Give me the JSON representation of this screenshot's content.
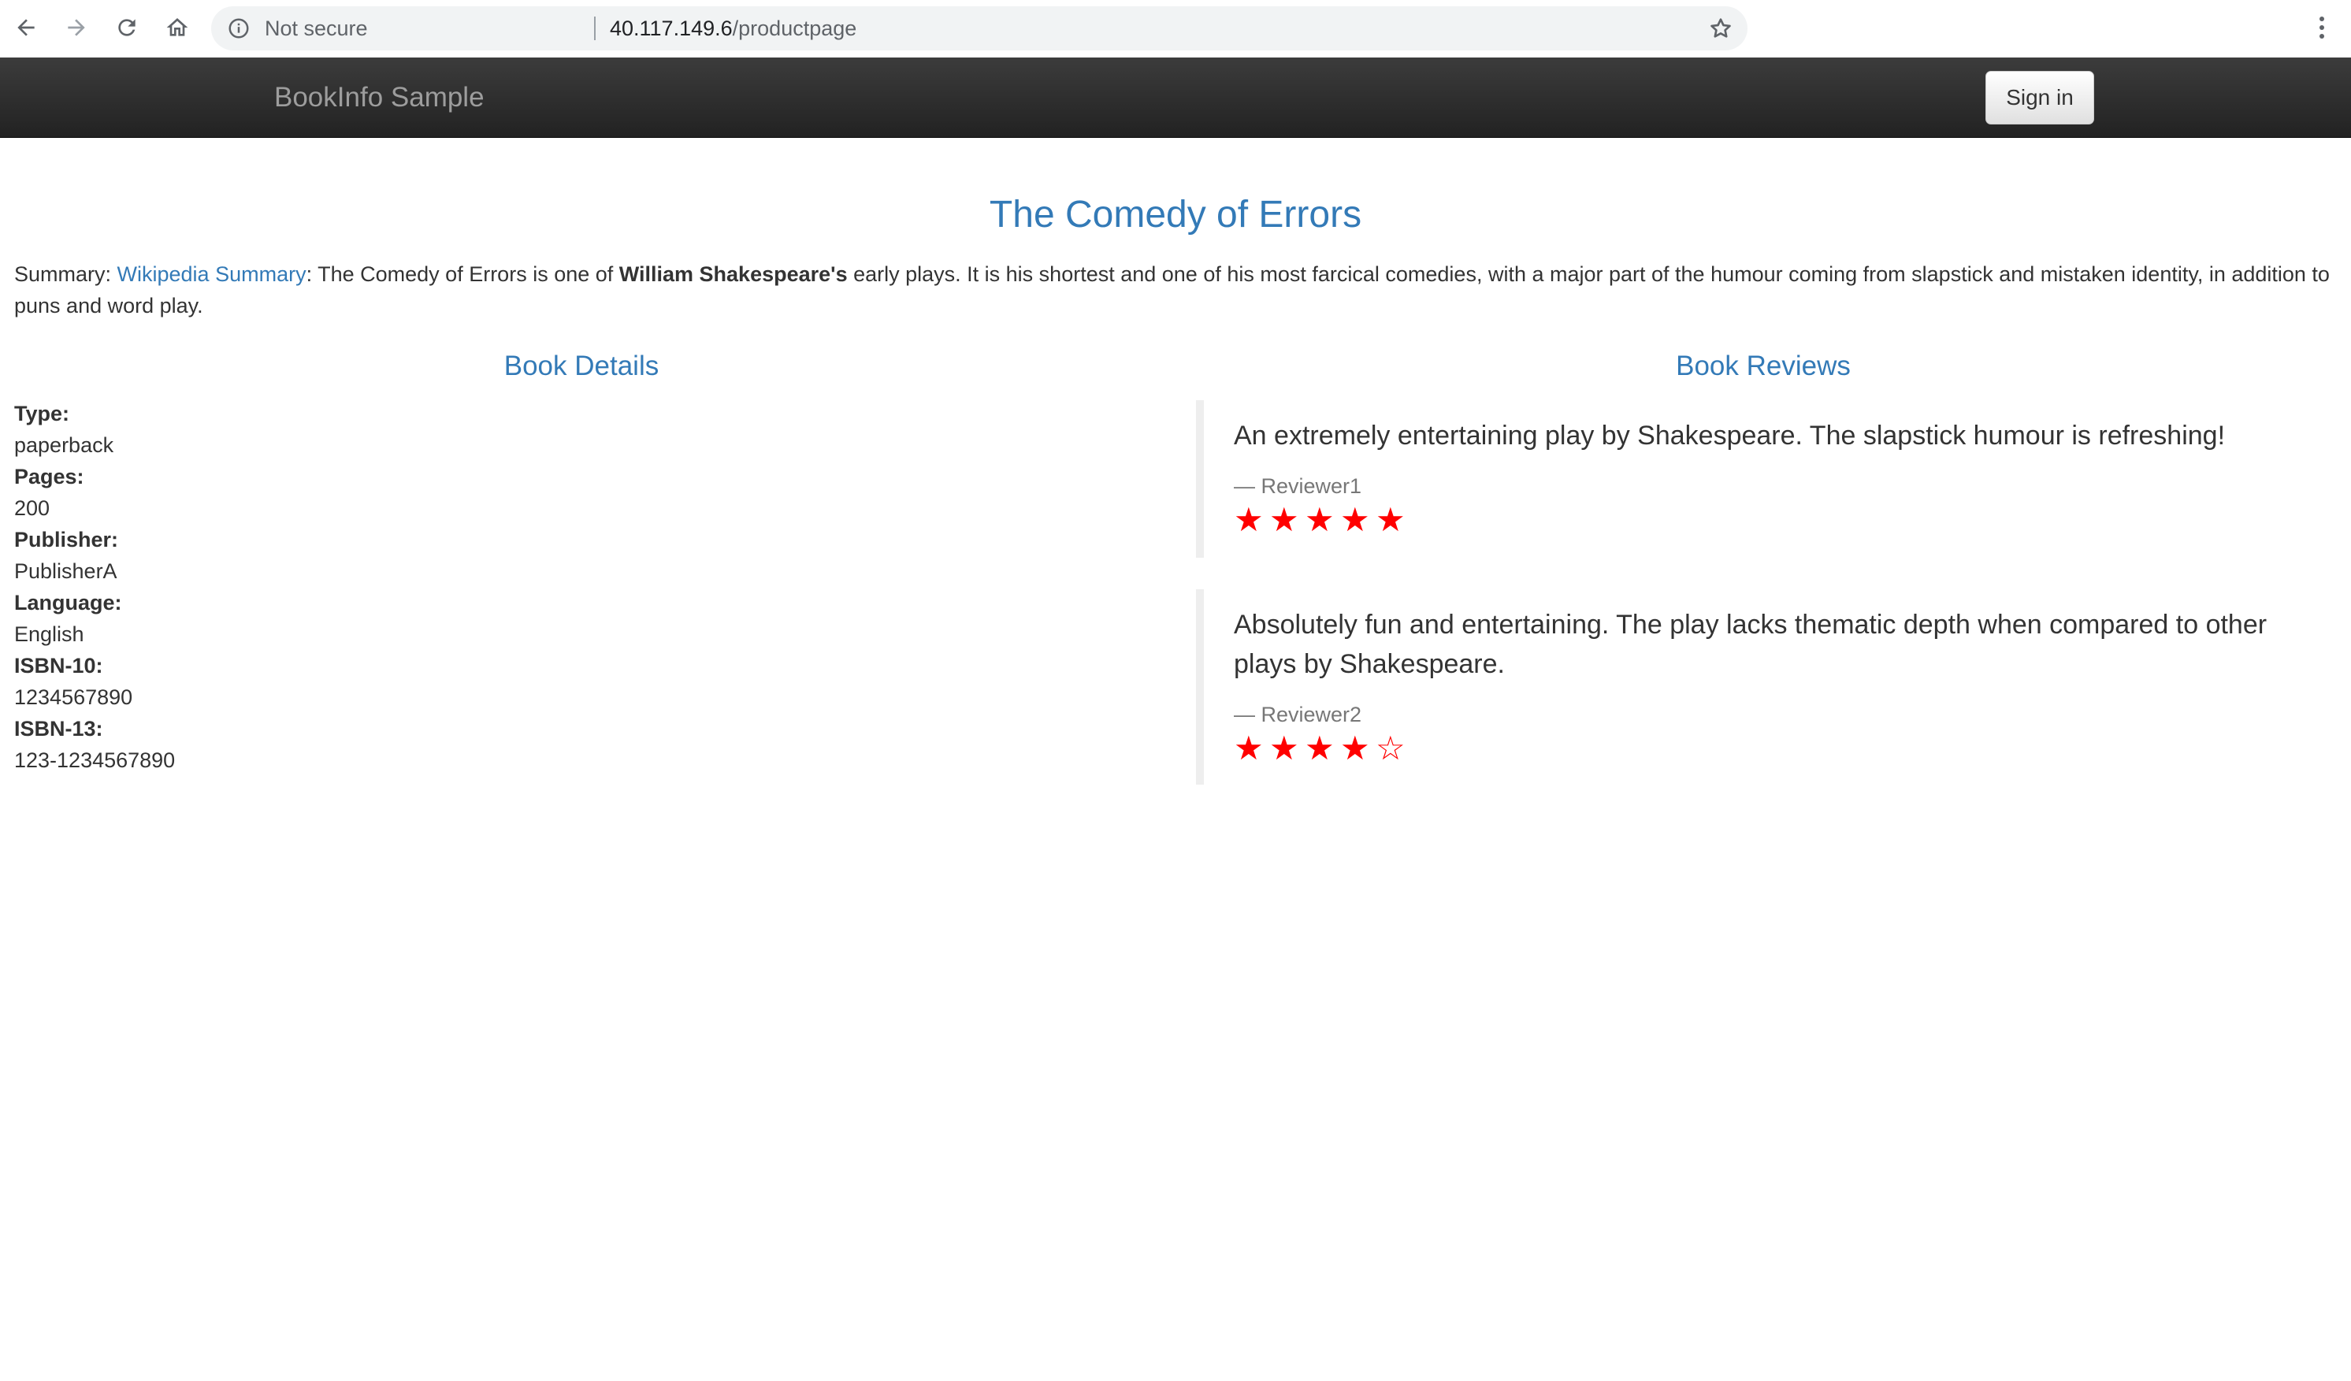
{
  "browser": {
    "back_icon": "arrow-left-icon",
    "forward_icon": "arrow-right-icon",
    "reload_icon": "reload-icon",
    "home_icon": "home-icon",
    "security_label": "Not secure",
    "url_host": "40.117.149.6",
    "url_path": "/productpage",
    "bookmark_icon": "star-outline-icon",
    "menu_icon": "kebab-menu-icon"
  },
  "navbar": {
    "brand": "BookInfo Sample",
    "signin_label": "Sign in"
  },
  "book": {
    "title": "The Comedy of Errors",
    "summary_prefix": "Summary: ",
    "summary_link": "Wikipedia Summary",
    "summary_text_1": ": The Comedy of Errors is one of ",
    "summary_bold": "William Shakespeare's",
    "summary_text_2": " early plays. It is his shortest and one of his most farcical comedies, with a major part of the humour coming from slapstick and mistaken identity, in addition to puns and word play."
  },
  "details": {
    "section_title": "Book Details",
    "items": [
      {
        "label": "Type:",
        "value": "paperback"
      },
      {
        "label": "Pages:",
        "value": "200"
      },
      {
        "label": "Publisher:",
        "value": "PublisherA"
      },
      {
        "label": "Language:",
        "value": "English"
      },
      {
        "label": "ISBN-10:",
        "value": "1234567890"
      },
      {
        "label": "ISBN-13:",
        "value": "123-1234567890"
      }
    ]
  },
  "reviews": {
    "section_title": "Book Reviews",
    "star_color": "#ff0000",
    "items": [
      {
        "text": "An extremely entertaining play by Shakespeare. The slapstick humour is refreshing!",
        "author": "— Reviewer1",
        "rating": 5,
        "max_rating": 5
      },
      {
        "text": "Absolutely fun and entertaining. The play lacks thematic depth when compared to other plays by Shakespeare.",
        "author": "— Reviewer2",
        "rating": 4,
        "max_rating": 5
      }
    ]
  }
}
